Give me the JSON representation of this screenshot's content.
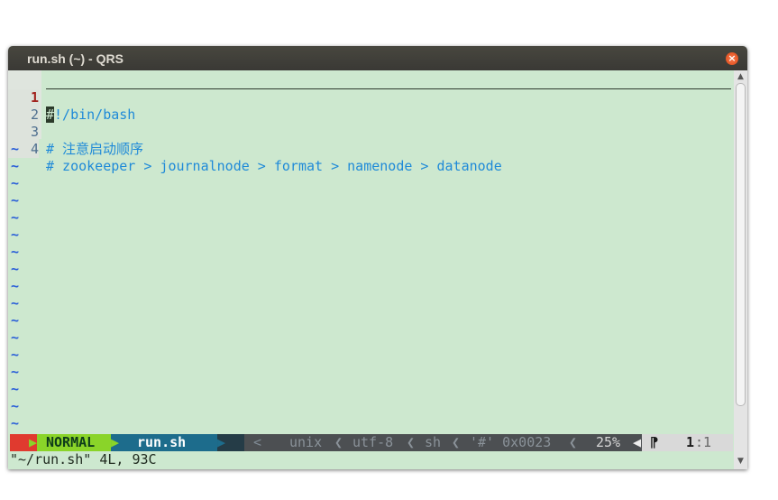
{
  "window": {
    "title": "run.sh (~) - QRS",
    "close_glyph": "×"
  },
  "editor": {
    "lines": [
      {
        "num": "1",
        "cursor_char": "#",
        "text": "!/bin/bash"
      },
      {
        "num": "2",
        "text": ""
      },
      {
        "num": "3",
        "text": "# 注意启动顺序"
      },
      {
        "num": "4",
        "text": "# zookeeper > journalnode > format > namenode > datanode"
      }
    ],
    "tilde": "~",
    "tilde_count": 17
  },
  "status": {
    "mode": "NORMAL",
    "filename": "run.sh",
    "right_sep": "<",
    "fileformat": "unix",
    "encoding": "utf-8",
    "filetype": "sh",
    "char_info": "'#' 0x0023",
    "percent": "25%",
    "flag_glyph": "⁋",
    "line": "1",
    "col": "1"
  },
  "cmdline": "\"~/run.sh\" 4L, 93C",
  "colors": {
    "background": "#cde8cf",
    "comment": "#1f8ad8",
    "mode_bg": "#8ad429",
    "file_bg": "#1d6c8c",
    "status_bg": "#4c4f52"
  }
}
